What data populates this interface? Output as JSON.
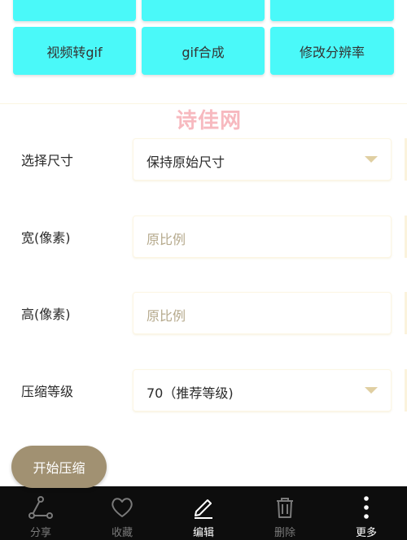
{
  "tools": {
    "row2": [
      "视频转gif",
      "gif合成",
      "修改分辨率"
    ]
  },
  "watermark": "诗佳网",
  "form": {
    "size": {
      "label": "选择尺寸",
      "value": "保持原始尺寸"
    },
    "width": {
      "label": "宽(像素)",
      "placeholder": "原比例"
    },
    "height": {
      "label": "高(像素)",
      "placeholder": "原比例"
    },
    "level": {
      "label": "压缩等级",
      "value": "70（推荐等级)"
    }
  },
  "start_button": "开始压缩",
  "bottom_nav": {
    "share": "分享",
    "favorite": "收藏",
    "edit": "编辑",
    "delete": "删除",
    "more": "更多"
  },
  "colors": {
    "tool_button": "#4af9f9",
    "start_button": "#a19172",
    "bottom_bar": "#0d0d0d",
    "watermark": "#f7b9bf"
  }
}
